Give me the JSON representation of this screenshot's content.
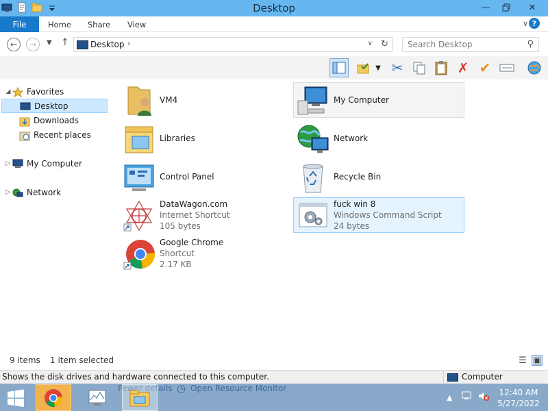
{
  "window": {
    "title": "Desktop"
  },
  "ribbon": {
    "tabs": [
      "File",
      "Home",
      "Share",
      "View"
    ],
    "help": "?"
  },
  "address": {
    "path": "Desktop",
    "search_placeholder": "Search Desktop"
  },
  "nav_pane": {
    "items": [
      {
        "label": "Favorites"
      },
      {
        "label": "Desktop"
      },
      {
        "label": "Downloads"
      },
      {
        "label": "Recent places"
      },
      {
        "label": "My Computer"
      },
      {
        "label": "Network"
      }
    ]
  },
  "content": {
    "items": [
      {
        "name": "VM4",
        "line2": "",
        "line3": ""
      },
      {
        "name": "Libraries",
        "line2": "",
        "line3": ""
      },
      {
        "name": "Control Panel",
        "line2": "",
        "line3": ""
      },
      {
        "name": "DataWagon.com",
        "line2": "Internet Shortcut",
        "line3": "105 bytes"
      },
      {
        "name": "Google Chrome",
        "line2": "Shortcut",
        "line3": "2.17 KB"
      },
      {
        "name": "My Computer",
        "line2": "",
        "line3": ""
      },
      {
        "name": "Network",
        "line2": "",
        "line3": ""
      },
      {
        "name": "Recycle Bin",
        "line2": "",
        "line3": ""
      },
      {
        "name": "fuck win 8",
        "line2": "Windows Command Script",
        "line3": "24 bytes"
      }
    ]
  },
  "status": {
    "count": "9 items",
    "selected": "1 item selected"
  },
  "infobar": {
    "text": "Shows the disk drives and hardware connected to this computer.",
    "right": "Computer"
  },
  "taskbar": {
    "ghost_left": "Fewer details",
    "ghost_link": "Open Resource Monitor",
    "time": "12:40 AM",
    "date": "5/27/2022"
  }
}
